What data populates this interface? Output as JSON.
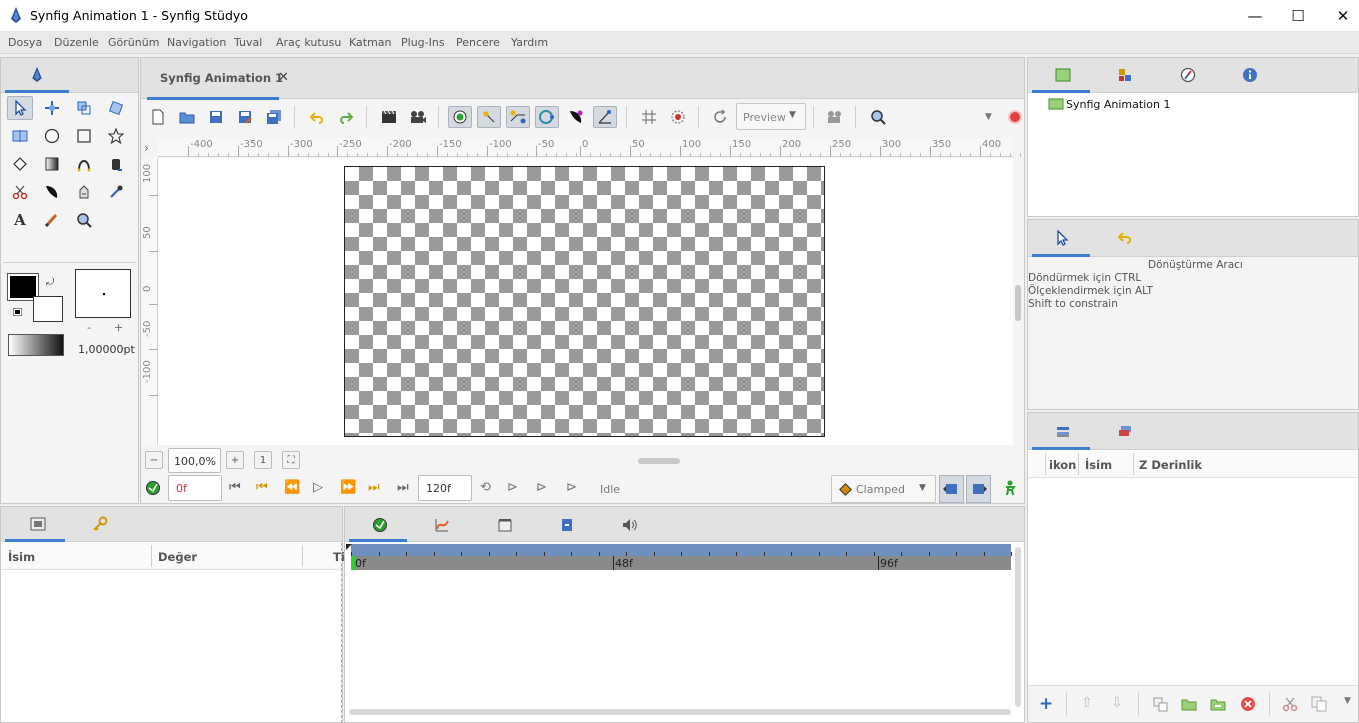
{
  "window": {
    "title": "Synfig Animation 1 - Synfig Stüdyo",
    "minimize": "—",
    "maximize": "☐",
    "close": "✕"
  },
  "menu": [
    "Dosya",
    "Düzenle",
    "Görünüm",
    "Navigation",
    "Tuval",
    "Araç kutusu",
    "Katman",
    "Plug-Ins",
    "Pencere",
    "Yardım"
  ],
  "doc_tab": {
    "label": "Synfig Animation 1",
    "close": "✕"
  },
  "toolbar": {
    "preview_label": "Preview"
  },
  "ruler_h": [
    "-400",
    "-350",
    "-300",
    "-250",
    "-200",
    "-150",
    "-100",
    "-50",
    "0",
    "50",
    "100",
    "150",
    "200",
    "250",
    "300",
    "350",
    "400"
  ],
  "ruler_v": [
    "100",
    "50",
    "0",
    "-50",
    "-100"
  ],
  "zoom": {
    "value": "100,0%"
  },
  "timebar": {
    "current_frame": "0f",
    "end_frame": "120f",
    "status": "Idle",
    "interpolation": "Clamped"
  },
  "toolbox": {
    "brush_size": "1,00000pt",
    "minus": "-",
    "plus": "+"
  },
  "canvas_browser": {
    "item": "Synfig Animation 1"
  },
  "tool_options": {
    "title": "Dönüştürme Aracı",
    "lines": [
      "Döndürmek için CTRL",
      "Ölçeklendirmek için ALT",
      "Shift to constrain"
    ]
  },
  "layers": {
    "col_icon": "ikon",
    "col_name": "İsim",
    "col_z": "Z Derinlik"
  },
  "params": {
    "col_name": "İsim",
    "col_value": "Değer",
    "col_time": "Ti"
  },
  "timetrack": {
    "labels": [
      "0f",
      "48f",
      "96f"
    ]
  },
  "colors": {
    "accent": "#3a7fd0",
    "timeline_bar": "#6f8fbf",
    "timeline_track": "#8a8a8a",
    "record": "#e04040"
  }
}
